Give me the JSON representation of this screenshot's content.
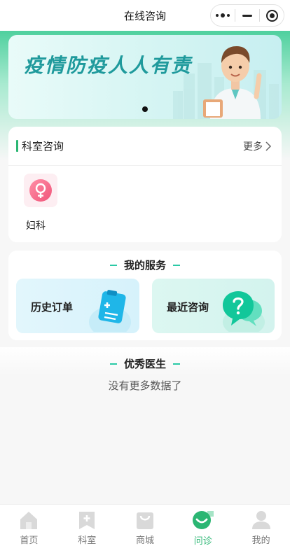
{
  "navbar": {
    "title": "在线咨询"
  },
  "banner": {
    "title": "疫情防疫人人有责"
  },
  "departments": {
    "title": "科室咨询",
    "more_label": "更多",
    "items": [
      {
        "label": "妇科",
        "icon": "female-symbol-icon"
      }
    ]
  },
  "services": {
    "title": "我的服务",
    "items": [
      {
        "label": "历史订单",
        "icon": "clipboard-icon"
      },
      {
        "label": "最近咨询",
        "icon": "question-chat-icon"
      }
    ]
  },
  "doctors": {
    "title": "优秀医生",
    "empty_text": "没有更多数据了"
  },
  "tabbar": {
    "items": [
      {
        "label": "首页",
        "icon": "home-icon"
      },
      {
        "label": "科室",
        "icon": "department-icon"
      },
      {
        "label": "商城",
        "icon": "shop-bag-icon"
      },
      {
        "label": "问诊",
        "icon": "consult-chat-icon"
      },
      {
        "label": "我的",
        "icon": "user-icon"
      }
    ],
    "active_index": 3
  },
  "colors": {
    "accent": "#2bb673",
    "banner_text": "#1f9a9c",
    "teal_dash": "#2bc9a6"
  }
}
